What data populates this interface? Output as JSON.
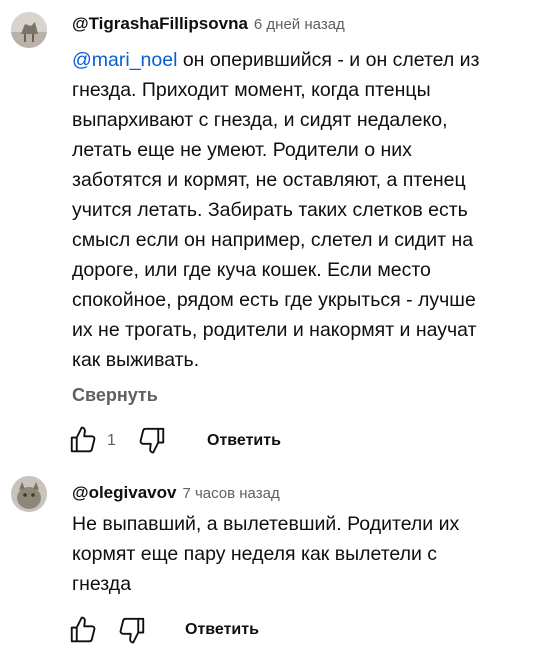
{
  "comments": [
    {
      "author": "@TigrashaFillipsovna",
      "time": "6 дней назад",
      "mention": "@mari_noel",
      "lines": [
        " он оперившийся - и он слетел из",
        "гнезда. Приходит момент, когда птенцы",
        "выпархивают с гнезда, и сидят недалеко,",
        "летать еще не умеют. Родители о них",
        "заботятся и кормят, не оставляют, а птенец",
        "учится летать. Забирать таких слетков есть",
        "смысл если он например, слетел и сидит на",
        "дороге, или где куча кошек. Если место",
        "спокойное, рядом есть где укрыться - лучше",
        "их не трогать, родители и накормят и научат",
        "как выживать."
      ],
      "collapse_label": "Свернуть",
      "like_count": "1",
      "reply_label": "Ответить",
      "icons": {
        "like": "thumbs-up-icon",
        "dislike": "thumbs-down-icon"
      }
    },
    {
      "author": "@olegivavov",
      "time": "7 часов назад",
      "lines": [
        "Не выпавший, а вылетевший. Родители их",
        "кормят еще пару неделя как вылетели с",
        "гнезда"
      ],
      "reply_label": "Ответить",
      "icons": {
        "like": "thumbs-up-icon",
        "dislike": "thumbs-down-icon"
      }
    }
  ],
  "colors": {
    "text": "#0f0f0f",
    "secondary": "#606060",
    "mention": "#065fd4",
    "background": "#ffffff"
  }
}
